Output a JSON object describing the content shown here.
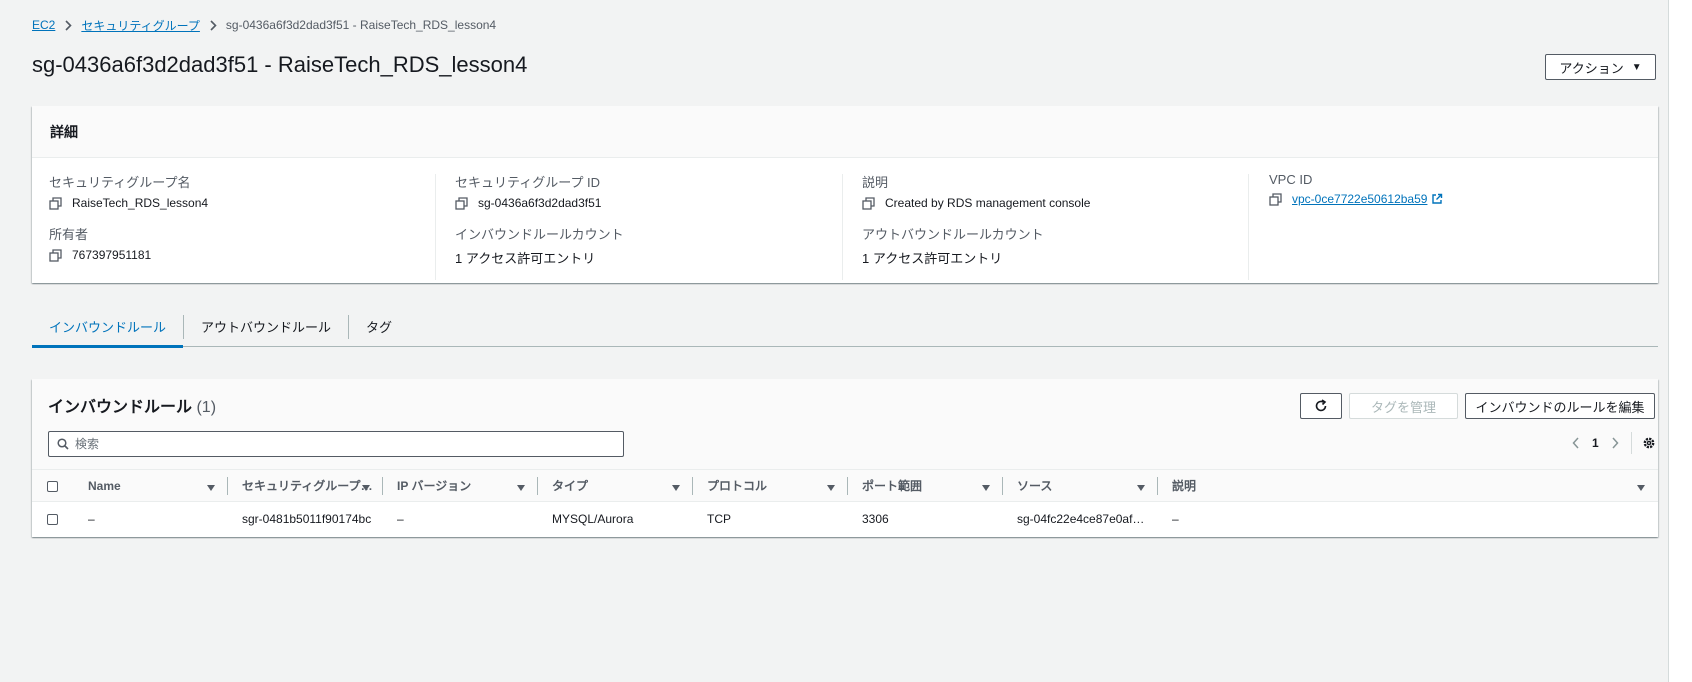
{
  "breadcrumb": {
    "items": [
      "EC2",
      "セキュリティグループ"
    ],
    "current": "sg-0436a6f3d2dad3f51 - RaiseTech_RDS_lesson4"
  },
  "page_title": "sg-0436a6f3d2dad3f51 - RaiseTech_RDS_lesson4",
  "actions_label": "アクション",
  "details": {
    "header": "詳細",
    "fields": {
      "sg_name": {
        "label": "セキュリティグループ名",
        "value": "RaiseTech_RDS_lesson4"
      },
      "sg_id": {
        "label": "セキュリティグループ ID",
        "value": "sg-0436a6f3d2dad3f51"
      },
      "description": {
        "label": "説明",
        "value": "Created by RDS management console"
      },
      "vpc_id": {
        "label": "VPC ID",
        "value": "vpc-0ce7722e50612ba59"
      },
      "owner": {
        "label": "所有者",
        "value": "767397951181"
      },
      "inbound_count": {
        "label": "インバウンドルールカウント",
        "value": "1 アクセス許可エントリ"
      },
      "outbound_count": {
        "label": "アウトバウンドルールカウント",
        "value": "1 アクセス許可エントリ"
      }
    }
  },
  "tabs": [
    "インバウンドルール",
    "アウトバウンドルール",
    "タグ"
  ],
  "rules": {
    "title": "インバウンドルール",
    "count": "(1)",
    "manage_tags_label": "タグを管理",
    "edit_label": "インバウンドのルールを編集",
    "search_placeholder": "検索",
    "page": "1",
    "columns": [
      "Name",
      "セキュリティグループルール ID",
      "IP バージョン",
      "タイプ",
      "プロトコル",
      "ポート範囲",
      "ソース",
      "説明"
    ],
    "rows": [
      [
        "–",
        "sgr-0481b5011f90174bc",
        "–",
        "MYSQL/Aurora",
        "TCP",
        "3306",
        "sg-04fc22e4ce87e0af…",
        "–"
      ]
    ]
  },
  "colors": {
    "link": "#0073bb",
    "text": "#16191f",
    "muted": "#545b64",
    "background": "#f2f3f3"
  },
  "icons": [
    "chevron-right-icon",
    "copy-icon",
    "external-link-icon",
    "caret-down-icon",
    "refresh-icon",
    "search-icon",
    "chevron-left-icon",
    "settings-icon",
    "sort-caret-icon"
  ]
}
